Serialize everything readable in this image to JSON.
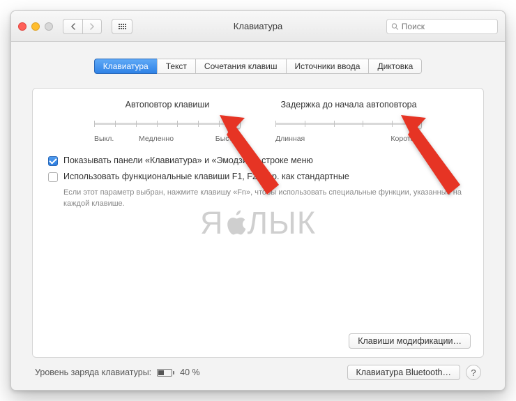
{
  "window": {
    "title": "Клавиатура"
  },
  "search": {
    "placeholder": "Поиск"
  },
  "tabs": [
    {
      "label": "Клавиатура",
      "active": true
    },
    {
      "label": "Текст",
      "active": false
    },
    {
      "label": "Сочетания клавиш",
      "active": false
    },
    {
      "label": "Источники ввода",
      "active": false
    },
    {
      "label": "Диктовка",
      "active": false
    }
  ],
  "sliders": {
    "repeat": {
      "label": "Автоповтор клавиши",
      "scale": [
        "Выкл.",
        "Медленно",
        "Быстро"
      ],
      "ticks": 8,
      "value_index": 7
    },
    "delay": {
      "label": "Задержка до начала автоповтора",
      "scale": [
        "Длинная",
        "Короткая"
      ],
      "ticks": 6,
      "value_index": 5
    }
  },
  "checkboxes": {
    "show_panels": {
      "checked": true,
      "label": "Показывать панели «Клавиатура» и «Эмодзи» в строке меню"
    },
    "fn_keys": {
      "checked": false,
      "label": "Использовать функциональные клавиши F1, F2 и др. как стандартные",
      "help": "Если этот параметр выбран, нажмите клавишу «Fn», чтобы использовать специальные функции, указанные на каждой клавише."
    }
  },
  "buttons": {
    "modifier_keys": "Клавиши модификации…",
    "bluetooth": "Клавиатура Bluetooth…",
    "help": "?"
  },
  "footer": {
    "battery_label": "Уровень заряда клавиатуры:",
    "battery_value": "40 %"
  },
  "watermark": {
    "left": "Я",
    "right": "ЛЫК"
  }
}
